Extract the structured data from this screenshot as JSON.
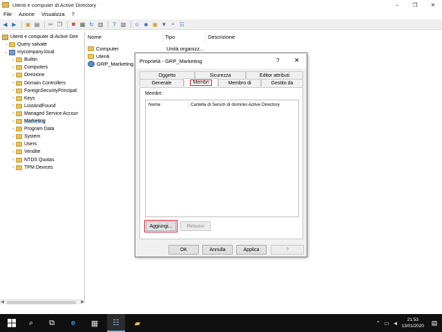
{
  "window": {
    "title": "Utenti e computer di Active Directory",
    "controls": [
      "–",
      "❐",
      "✕"
    ]
  },
  "menu": [
    "File",
    "Azione",
    "Visualizza",
    "?"
  ],
  "tree": {
    "root": "Utenti e computer di Active Dire",
    "items": [
      {
        "label": "Query salvate",
        "level": 1,
        "expander": "›"
      },
      {
        "label": "mycompany.local",
        "level": 1,
        "expander": "⌄"
      },
      {
        "label": "Builtin",
        "level": 2,
        "expander": "›"
      },
      {
        "label": "Computers",
        "level": 2,
        "expander": "›"
      },
      {
        "label": "Direzione",
        "level": 2,
        "expander": "›"
      },
      {
        "label": "Domain Controllers",
        "level": 2,
        "expander": "›"
      },
      {
        "label": "ForeignSecurityPrincipal:",
        "level": 2,
        "expander": "›"
      },
      {
        "label": "Keys",
        "level": 2,
        "expander": "›"
      },
      {
        "label": "LostAndFound",
        "level": 2,
        "expander": "›"
      },
      {
        "label": "Managed Service Accour",
        "level": 2,
        "expander": "›"
      },
      {
        "label": "Marketing",
        "level": 2,
        "expander": "›",
        "selected": true
      },
      {
        "label": "Program Data",
        "level": 2,
        "expander": "›"
      },
      {
        "label": "System",
        "level": 2,
        "expander": "›"
      },
      {
        "label": "Users",
        "level": 2,
        "expander": "›"
      },
      {
        "label": "Vendite",
        "level": 2,
        "expander": "›"
      },
      {
        "label": "NTDS Quotas",
        "level": 2,
        "expander": "›"
      },
      {
        "label": "TPM Devices",
        "level": 2,
        "expander": "›"
      }
    ]
  },
  "list": {
    "columns": [
      "Nome",
      "Tipo",
      "Descrizione"
    ],
    "rows": [
      {
        "name": "Computer",
        "type": "Unità organizz...",
        "icon": "folder-icon"
      },
      {
        "name": "Utenti",
        "type": "",
        "icon": "folder-icon"
      },
      {
        "name": "GRP_Marketing",
        "type": "",
        "icon": "group-icon"
      }
    ]
  },
  "dialog": {
    "title": "Proprietà - GRP_Marketing",
    "help": "?",
    "close": "✕",
    "tabs_row1": [
      "Oggetto",
      "Sicurezza",
      "Editor attributi"
    ],
    "tabs_row2": [
      "Generale",
      "Membri",
      "Membro di",
      "Gestito da"
    ],
    "active_tab": "Membri",
    "members_label": "Membri:",
    "members_columns": [
      "Nome",
      "Cartella di Servizi di dominio Active Directory"
    ],
    "add_button": "Aggiungi...",
    "remove_button": "Rimuovi",
    "ok_button": "OK",
    "cancel_button": "Annulla",
    "apply_button": "Applica",
    "help_button": "?"
  },
  "taskbar": {
    "time": "21:53",
    "date": "13/01/2020"
  },
  "colors": {
    "highlight_red": "#d0182e",
    "selection": "#cce4f7",
    "taskbar": "#101010"
  }
}
